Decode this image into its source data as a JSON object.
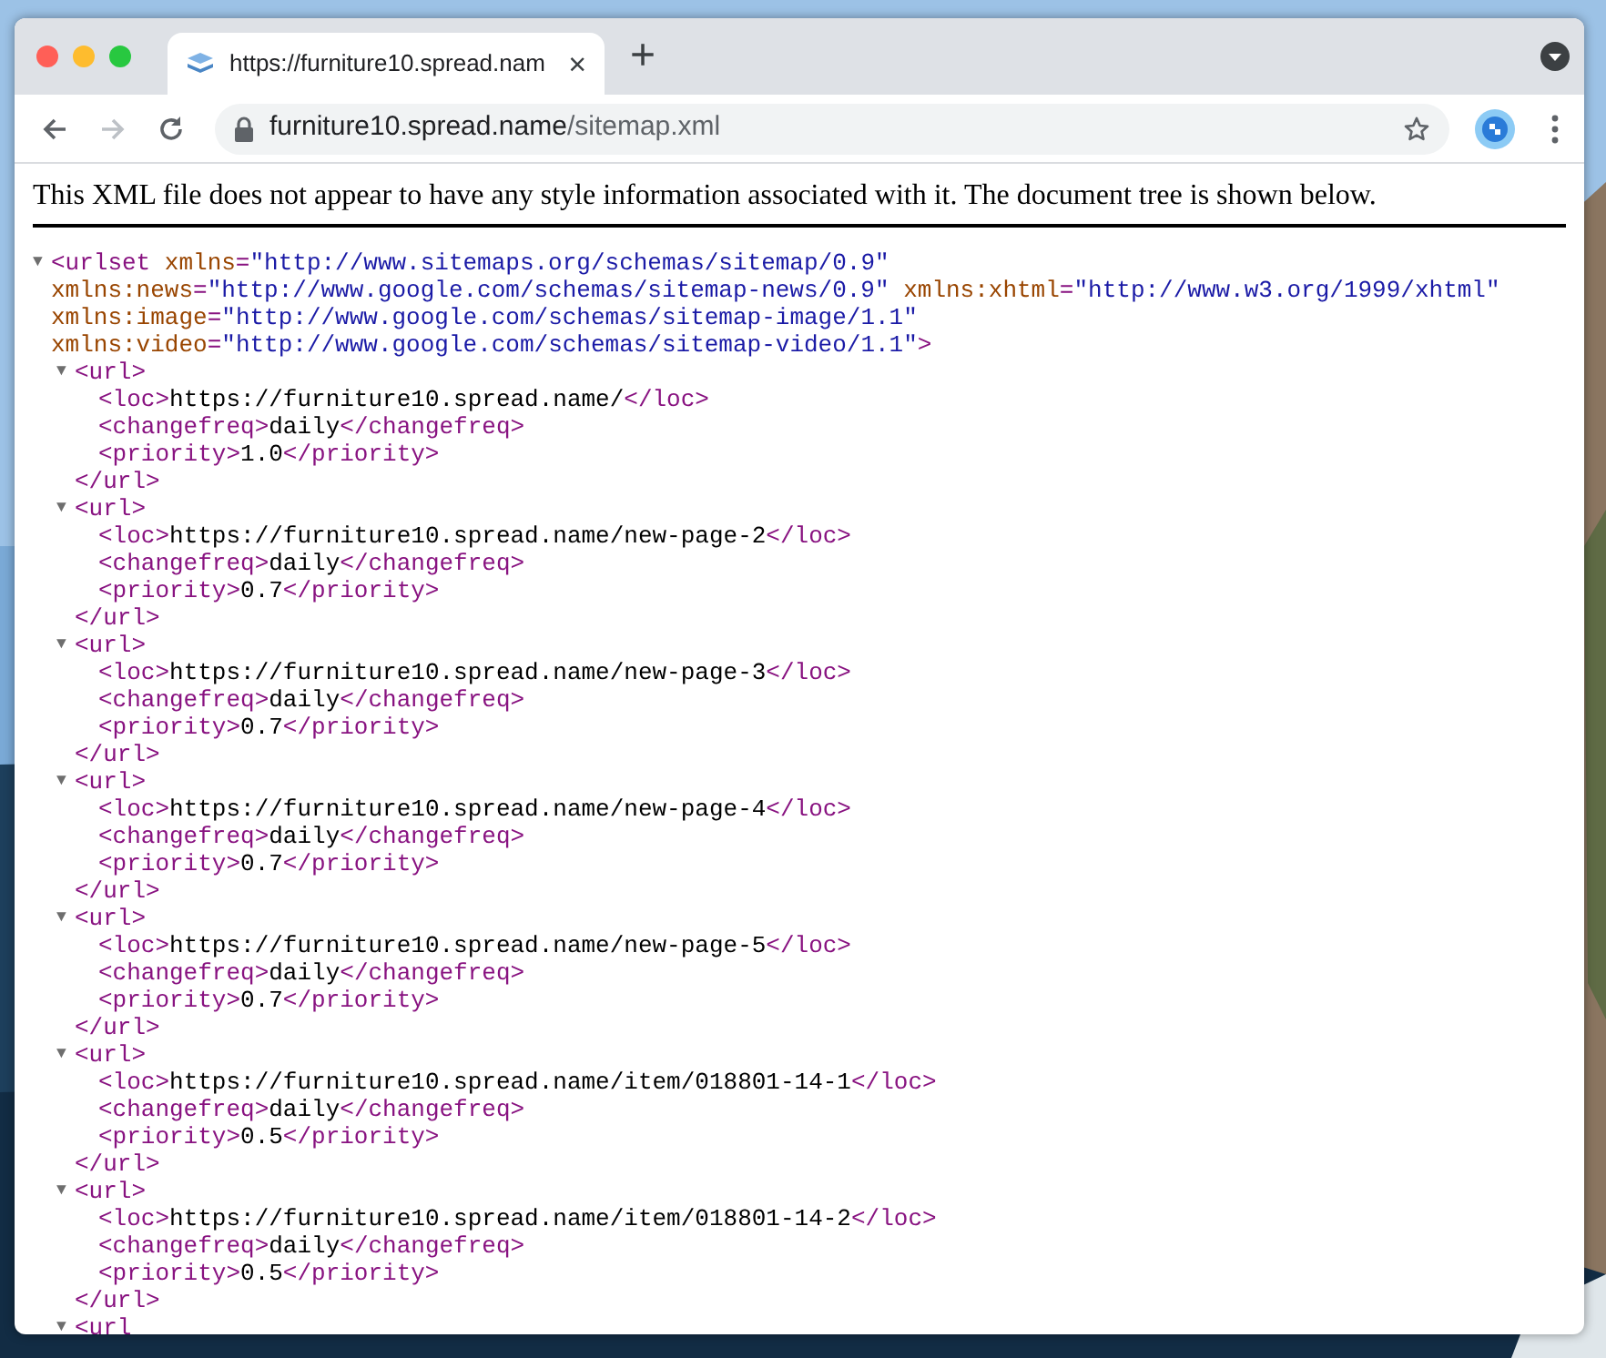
{
  "browser": {
    "tab": {
      "title": "https://furniture10.spread.nam",
      "close": "×"
    },
    "new_tab": "+",
    "nav": [
      {
        "kind": "back",
        "disabled": false
      },
      {
        "kind": "forward",
        "disabled": true
      },
      {
        "kind": "reload",
        "disabled": false
      }
    ],
    "address": {
      "host": "furniture10.spread.name",
      "path": "/sitemap.xml"
    }
  },
  "notice": "This XML file does not appear to have any style information associated with it. The document tree is shown below.",
  "tree": {
    "expanded": true,
    "toggle": "▼",
    "open_lines": [
      [
        {
          "kind": "tag",
          "text": "<urlset"
        },
        {
          "kind": "attr",
          "text": " xmlns"
        },
        {
          "kind": "tag",
          "text": "="
        },
        {
          "kind": "value",
          "text": "\"http://www.sitemaps.org/schemas/sitemap/0.9\""
        }
      ],
      [
        {
          "kind": "attr",
          "text": "xmlns:news"
        },
        {
          "kind": "tag",
          "text": "="
        },
        {
          "kind": "value",
          "text": "\"http://www.google.com/schemas/sitemap-news/0.9\""
        },
        {
          "kind": "attr",
          "text": " xmlns:xhtml"
        },
        {
          "kind": "tag",
          "text": "="
        },
        {
          "kind": "value",
          "text": "\"http://www.w3.org/1999/xhtml\""
        }
      ],
      [
        {
          "kind": "attr",
          "text": "xmlns:image"
        },
        {
          "kind": "tag",
          "text": "="
        },
        {
          "kind": "value",
          "text": "\"http://www.google.com/schemas/sitemap-image/1.1\""
        }
      ],
      [
        {
          "kind": "attr",
          "text": "xmlns:video"
        },
        {
          "kind": "tag",
          "text": "="
        },
        {
          "kind": "value",
          "text": "\"http://www.google.com/schemas/sitemap-video/1.1\""
        },
        {
          "kind": "tag",
          "text": ">"
        }
      ]
    ],
    "children": [
      {
        "expanded": true,
        "toggle": "▼",
        "open": "<url>",
        "close": "</url>",
        "children": [
          {
            "open": "<loc>",
            "text": "https://furniture10.spread.name/",
            "close": "</loc>"
          },
          {
            "open": "<changefreq>",
            "text": "daily",
            "close": "</changefreq>"
          },
          {
            "open": "<priority>",
            "text": "1.0",
            "close": "</priority>"
          }
        ]
      },
      {
        "expanded": true,
        "toggle": "▼",
        "open": "<url>",
        "close": "</url>",
        "children": [
          {
            "open": "<loc>",
            "text": "https://furniture10.spread.name/new-page-2",
            "close": "</loc>"
          },
          {
            "open": "<changefreq>",
            "text": "daily",
            "close": "</changefreq>"
          },
          {
            "open": "<priority>",
            "text": "0.7",
            "close": "</priority>"
          }
        ]
      },
      {
        "expanded": true,
        "toggle": "▼",
        "open": "<url>",
        "close": "</url>",
        "children": [
          {
            "open": "<loc>",
            "text": "https://furniture10.spread.name/new-page-3",
            "close": "</loc>"
          },
          {
            "open": "<changefreq>",
            "text": "daily",
            "close": "</changefreq>"
          },
          {
            "open": "<priority>",
            "text": "0.7",
            "close": "</priority>"
          }
        ]
      },
      {
        "expanded": true,
        "toggle": "▼",
        "open": "<url>",
        "close": "</url>",
        "children": [
          {
            "open": "<loc>",
            "text": "https://furniture10.spread.name/new-page-4",
            "close": "</loc>"
          },
          {
            "open": "<changefreq>",
            "text": "daily",
            "close": "</changefreq>"
          },
          {
            "open": "<priority>",
            "text": "0.7",
            "close": "</priority>"
          }
        ]
      },
      {
        "expanded": true,
        "toggle": "▼",
        "open": "<url>",
        "close": "</url>",
        "children": [
          {
            "open": "<loc>",
            "text": "https://furniture10.spread.name/new-page-5",
            "close": "</loc>"
          },
          {
            "open": "<changefreq>",
            "text": "daily",
            "close": "</changefreq>"
          },
          {
            "open": "<priority>",
            "text": "0.7",
            "close": "</priority>"
          }
        ]
      },
      {
        "expanded": true,
        "toggle": "▼",
        "open": "<url>",
        "close": "</url>",
        "children": [
          {
            "open": "<loc>",
            "text": "https://furniture10.spread.name/item/018801-14-1",
            "close": "</loc>"
          },
          {
            "open": "<changefreq>",
            "text": "daily",
            "close": "</changefreq>"
          },
          {
            "open": "<priority>",
            "text": "0.5",
            "close": "</priority>"
          }
        ]
      },
      {
        "expanded": true,
        "toggle": "▼",
        "open": "<url>",
        "close": "</url>",
        "children": [
          {
            "open": "<loc>",
            "text": "https://furniture10.spread.name/item/018801-14-2",
            "close": "</loc>"
          },
          {
            "open": "<changefreq>",
            "text": "daily",
            "close": "</changefreq>"
          },
          {
            "open": "<priority>",
            "text": "0.5",
            "close": "</priority>"
          }
        ]
      },
      {
        "expanded": true,
        "toggle": "▼",
        "open": "<url"
      }
    ]
  }
}
